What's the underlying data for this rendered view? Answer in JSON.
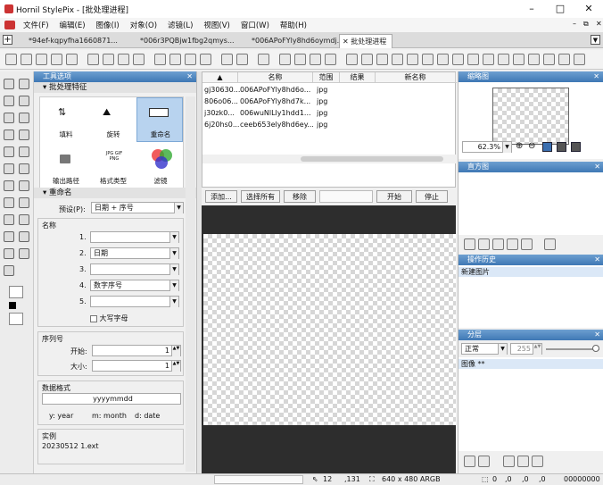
{
  "window": {
    "title": "Hornil StylePix - [批处理进程]",
    "minimize": "–",
    "maximize": "□",
    "close": "✕"
  },
  "menu": [
    "文件(F)",
    "编辑(E)",
    "图像(I)",
    "对象(O)",
    "滤镜(L)",
    "视图(V)",
    "窗口(W)",
    "帮助(H)"
  ],
  "mdi_buttons": {
    "min": "–",
    "restore": "⧉",
    "close": "✕"
  },
  "tabs": [
    {
      "label": "*94ef-kqpyfha1660871..."
    },
    {
      "label": "*006r3PQBjw1fbg2qmys..."
    },
    {
      "label": "*006APoFYly8hd6oymdj..."
    },
    {
      "label": "✕ 批处理进程"
    }
  ],
  "tools_panel": {
    "header": "工具选项",
    "batch_section": "批处理特征",
    "features": [
      {
        "label": "填料"
      },
      {
        "label": "旋转"
      },
      {
        "label": "重命名"
      },
      {
        "label": "输出路径"
      },
      {
        "label": "格式类型"
      },
      {
        "label": "滤镜"
      }
    ],
    "format_icon_text": "JPG GIF PNG",
    "rename_section": "重命名",
    "preset_label": "预设(P):",
    "preset_value": "日期 + 序号",
    "name_group": "名称",
    "name_rows": [
      {
        "num": "1.",
        "value": ""
      },
      {
        "num": "2.",
        "value": "日期"
      },
      {
        "num": "3.",
        "value": ""
      },
      {
        "num": "4.",
        "value": "数字序号"
      },
      {
        "num": "5.",
        "value": ""
      }
    ],
    "uppercase_label": "大写字母",
    "sequence_group": "序列号",
    "start_label": "开始:",
    "start_value": "1",
    "size_label": "大小:",
    "size_value": "1",
    "date_group": "数据格式",
    "date_format": "yyyymmdd",
    "date_hint": [
      "y: year",
      "m: month",
      "d: date"
    ],
    "example_group": "实例",
    "example_value": "20230512 1.ext"
  },
  "file_table": {
    "columns": [
      "名称",
      "范围",
      "结果",
      "新名称"
    ],
    "rows": [
      {
        "left": "gj30630...",
        "name": "006APoFYly8hd6o...",
        "type": "jpg"
      },
      {
        "left": "806o06...",
        "name": "006APoFYly8hd7k...",
        "type": "jpg"
      },
      {
        "left": "j30zk0...",
        "name": "006wuNlLly1hdd1...",
        "type": "jpg"
      },
      {
        "left": "6j20hs0...",
        "name": "ceeb653ely8hd6ey...",
        "type": "jpg"
      }
    ]
  },
  "actions": {
    "add": "添加...",
    "select_all": "选择所有",
    "remove": "移除",
    "start": "开始",
    "stop": "停止"
  },
  "right_panels": {
    "thumbnail": "缩略图",
    "zoom_value": "62.3%",
    "histogram": "直方图",
    "history": "操作历史",
    "history_item": "新建图片",
    "layers": "分层",
    "blend_mode": "正常",
    "opacity": "255",
    "layer_item": "图像 **"
  },
  "status": {
    "cursor_x": "12",
    "cursor_y": ",131",
    "size": "640 x 480 ARGB",
    "pos_a": "0",
    "pos_b": ",0",
    "pos_c": ",0",
    "pos_d": ",0",
    "color": "00000000"
  }
}
